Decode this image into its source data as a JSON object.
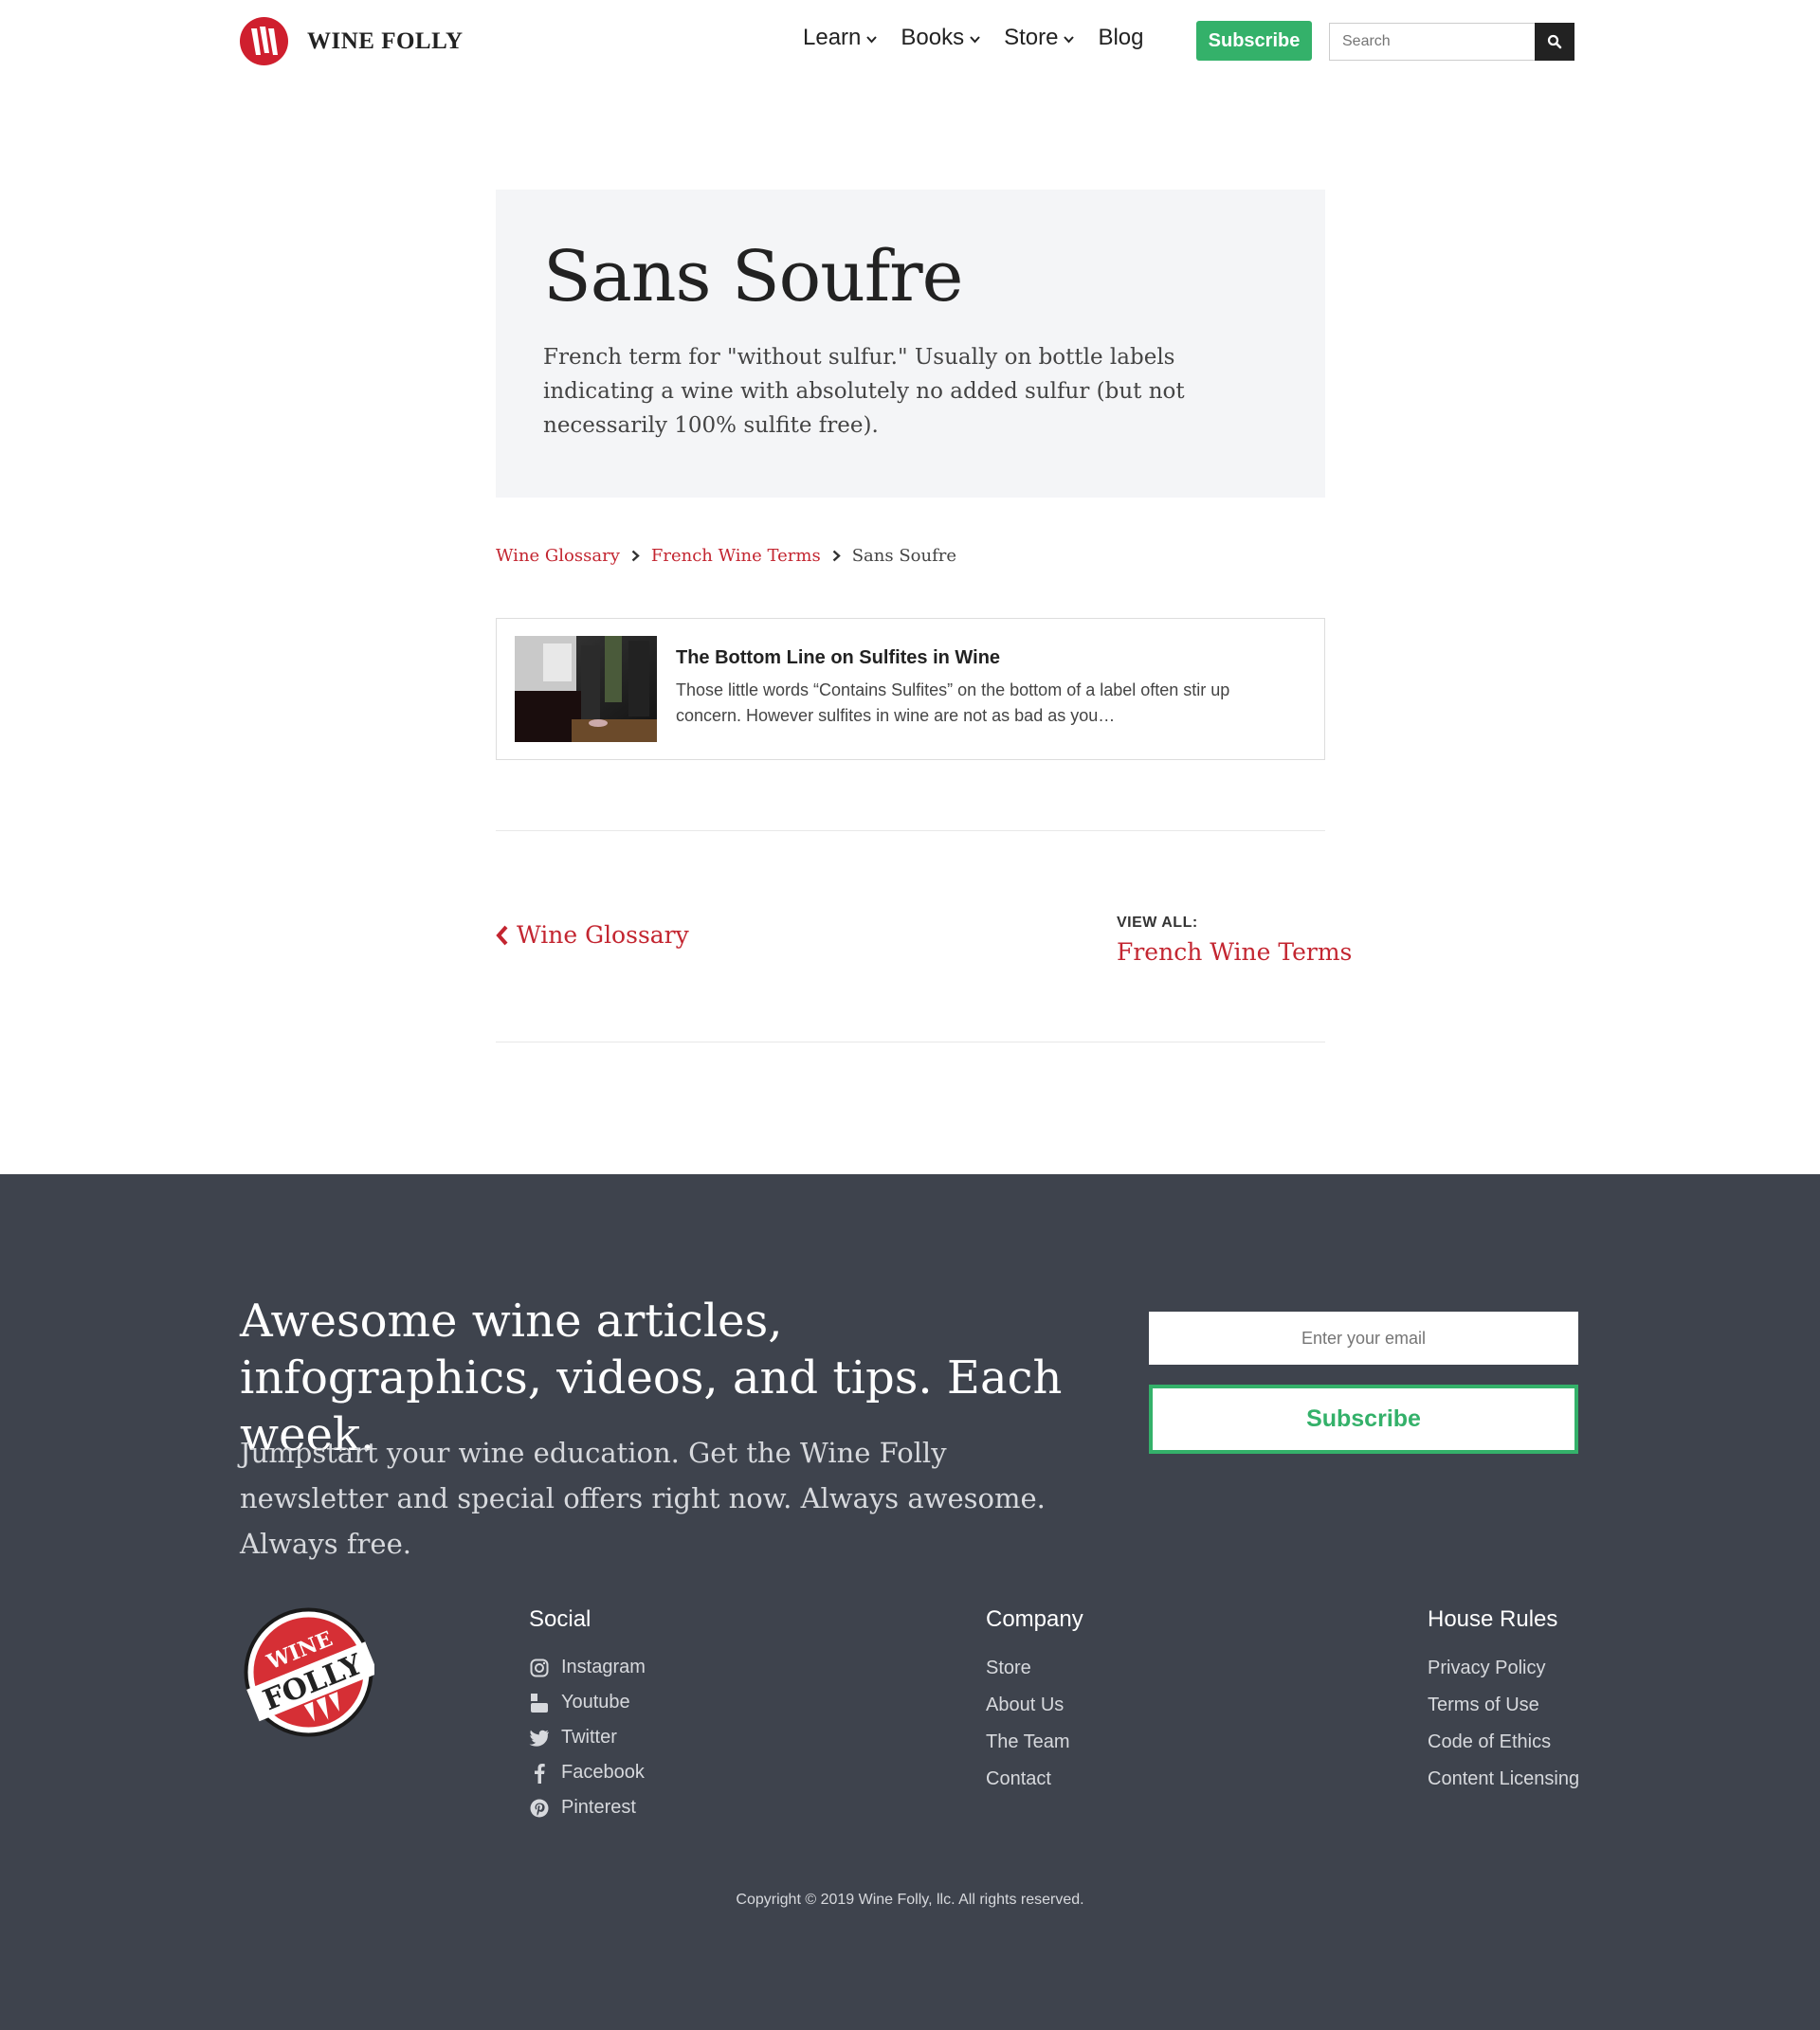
{
  "header": {
    "logo_text": "WINE FOLLY",
    "nav": [
      {
        "label": "Learn",
        "has_dropdown": true
      },
      {
        "label": "Books",
        "has_dropdown": true
      },
      {
        "label": "Store",
        "has_dropdown": true
      },
      {
        "label": "Blog",
        "has_dropdown": false
      }
    ],
    "subscribe_label": "Subscribe",
    "search_placeholder": "Search"
  },
  "hero": {
    "title": "Sans Soufre",
    "definition": "French term for \"without sulfur.\" Usually on bottle labels indicating a wine with absolutely no added sulfur (but not necessarily 100% sulfite free)."
  },
  "breadcrumb": {
    "items": [
      "Wine Glossary",
      "French Wine Terms"
    ],
    "current": "Sans Soufre"
  },
  "related_article": {
    "title": "The Bottom Line on Sulfites in Wine",
    "excerpt": "Those little words “Contains Sulfites” on the bottom of a label often stir up concern. However sulfites in wine are not as bad as you…"
  },
  "pager": {
    "prev_label": "Wine Glossary",
    "view_all_label": "VIEW ALL:",
    "view_all_link": "French Wine Terms"
  },
  "footer": {
    "headline": "Awesome wine articles, infographics, videos, and tips. Each week.",
    "subtext": "Jumpstart your wine education. Get the Wine Folly newsletter and special offers right now. Always awesome. Always free.",
    "email_placeholder": "Enter your email",
    "subscribe_label": "Subscribe",
    "badge_text": [
      "WINE",
      "FOLLY"
    ],
    "columns": {
      "social": {
        "title": "Social",
        "items": [
          {
            "label": "Instagram",
            "icon": "instagram-icon"
          },
          {
            "label": "Youtube",
            "icon": "youtube-icon"
          },
          {
            "label": "Twitter",
            "icon": "twitter-icon"
          },
          {
            "label": "Facebook",
            "icon": "facebook-icon"
          },
          {
            "label": "Pinterest",
            "icon": "pinterest-icon"
          }
        ]
      },
      "company": {
        "title": "Company",
        "items": [
          "Store",
          "About Us",
          "The Team",
          "Contact"
        ]
      },
      "house_rules": {
        "title": "House Rules",
        "items": [
          "Privacy Policy",
          "Terms of Use",
          "Code of Ethics",
          "Content Licensing"
        ]
      }
    },
    "copyright": "Copyright © 2019 Wine Folly, llc. All rights reserved."
  },
  "colors": {
    "brand_red": "#cf1f2e",
    "link_red": "#c32530",
    "green": "#34b16a",
    "footer_bg": "#3e434d",
    "hero_bg": "#f4f5f7"
  }
}
